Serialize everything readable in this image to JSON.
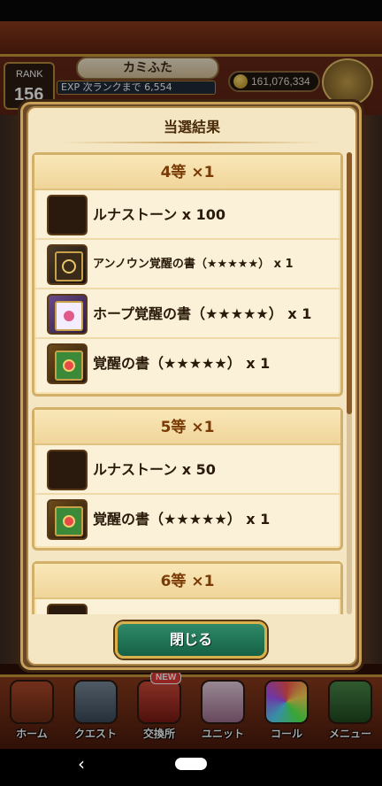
{
  "header": {
    "rank_label": "RANK",
    "rank_value": "156",
    "player_name": "カミふた",
    "exp_text": "EXP 次ランクまで 6,554",
    "coins": "161,076,334"
  },
  "modal": {
    "title": "当選結果",
    "prizes": [
      {
        "heading": "4等 ×1",
        "items": [
          {
            "icon": "luna-stone-icon",
            "label": "ルナストーン x 100"
          },
          {
            "icon": "unknown-awakening-book-icon",
            "label": "アンノウン覚醒の書（★★★★★） x 1"
          },
          {
            "icon": "hope-awakening-book-icon",
            "label": "ホープ覚醒の書（★★★★★） x 1"
          },
          {
            "icon": "awakening-book-icon",
            "label": "覚醒の書（★★★★★） x 1"
          }
        ]
      },
      {
        "heading": "5等 ×1",
        "items": [
          {
            "icon": "luna-stone-icon",
            "label": "ルナストーン x 50"
          },
          {
            "icon": "awakening-book-icon",
            "label": "覚醒の書（★★★★★） x 1"
          }
        ]
      },
      {
        "heading": "6等 ×1",
        "items": [
          {
            "icon": "luna-stone-icon",
            "label": ""
          }
        ]
      }
    ],
    "close_label": "閉じる"
  },
  "bottom_nav": {
    "items": [
      "ホーム",
      "クエスト",
      "交換所",
      "ユニット",
      "コール",
      "メニュー"
    ],
    "new_badge": "NEW"
  },
  "colors": {
    "accent_gold": "#d9b14a",
    "button_green": "#156046",
    "heading_brown": "#7a3a06"
  }
}
